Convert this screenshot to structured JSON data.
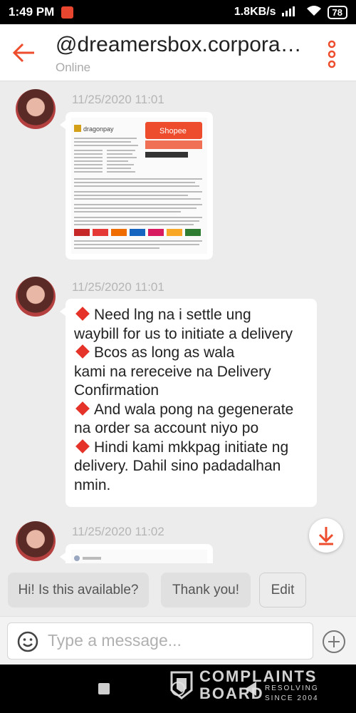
{
  "status_bar": {
    "time": "1:49 PM",
    "net_speed": "1.8KB/s",
    "battery": "78"
  },
  "header": {
    "title": "@dreamersbox.corporation",
    "status": "Online"
  },
  "messages": [
    {
      "timestamp": "11/25/2020 11:01",
      "type": "image"
    },
    {
      "timestamp": "11/25/2020 11:01",
      "type": "text",
      "lines": [
        {
          "bullet": true,
          "text": "Need lng na i settle ung"
        },
        {
          "bullet": false,
          "text": "waybill for us to initiate a delivery"
        },
        {
          "bullet": true,
          "text": "Bcos as long as wala"
        },
        {
          "bullet": false,
          "text": "kami na rereceive na Delivery"
        },
        {
          "bullet": false,
          "text": "Confirmation"
        },
        {
          "bullet": true,
          "text": "And wala pong na gegenerate"
        },
        {
          "bullet": false,
          "text": "na order sa account niyo po"
        },
        {
          "bullet": true,
          "text": "Hindi kami mkkpag initiate ng"
        },
        {
          "bullet": false,
          "text": "delivery. Dahil sino padadalhan"
        },
        {
          "bullet": false,
          "text": "nmin."
        }
      ]
    },
    {
      "timestamp": "11/25/2020 11:02",
      "type": "image"
    }
  ],
  "attachment": {
    "brand_left": "dragonpay",
    "brand_right": "Shopee"
  },
  "quick_replies": [
    "Hi! Is this available?",
    "Thank you!",
    "Edit"
  ],
  "composer": {
    "placeholder": "Type a message..."
  },
  "watermark": {
    "line1": "COMPLAINTS",
    "line2": "BOARD",
    "tag1": "RESOLVING",
    "tag2": "SINCE 2004"
  },
  "colors": {
    "accent": "#ee4d2d",
    "bullet": "#e5332a"
  },
  "icons": [
    "back-arrow-icon",
    "more-vertical-icon",
    "download-icon",
    "emoji-icon",
    "plus-circle-icon"
  ]
}
